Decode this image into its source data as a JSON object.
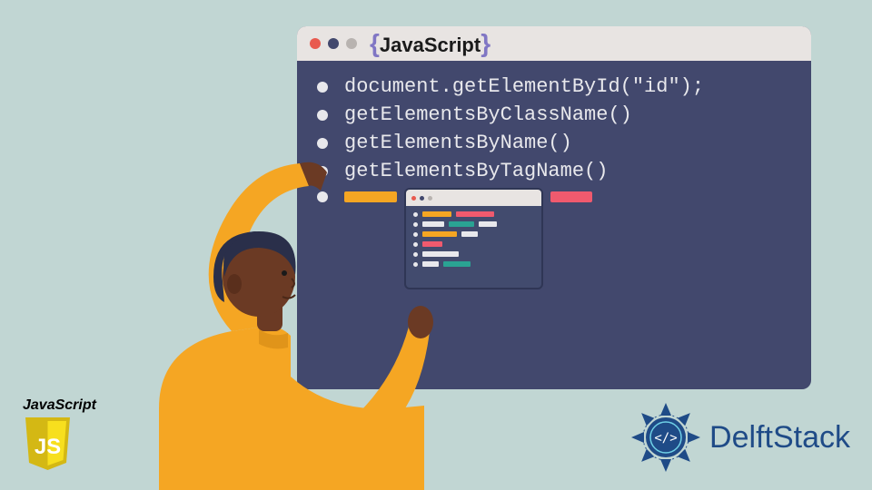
{
  "window": {
    "title": "JavaScript",
    "code_lines": [
      "document.getElementById(\"id\");",
      "getElementsByClassName()",
      "getElementsByName()",
      "getElementsByTagName()"
    ]
  },
  "colors": {
    "bg": "#c1d6d3",
    "window_bg": "#42486d",
    "titlebar": "#e8e4e2",
    "dot_red": "#e85a4f",
    "dot_navy": "#42486d",
    "dot_gray": "#b8b3b0",
    "brace": "#8076c4",
    "code_text": "#e8e8ec",
    "orange": "#f5a623",
    "pink": "#f05a6e",
    "teal": "#2aa393",
    "skin": "#6b3a24",
    "hair": "#2a2f4a",
    "shirt": "#f5a623",
    "js_yellow": "#f7df1e",
    "delft_blue": "#1f4b87"
  },
  "js_logo": {
    "label": "JavaScript",
    "badge_text": "JS"
  },
  "delft": {
    "text": "DelftStack"
  }
}
